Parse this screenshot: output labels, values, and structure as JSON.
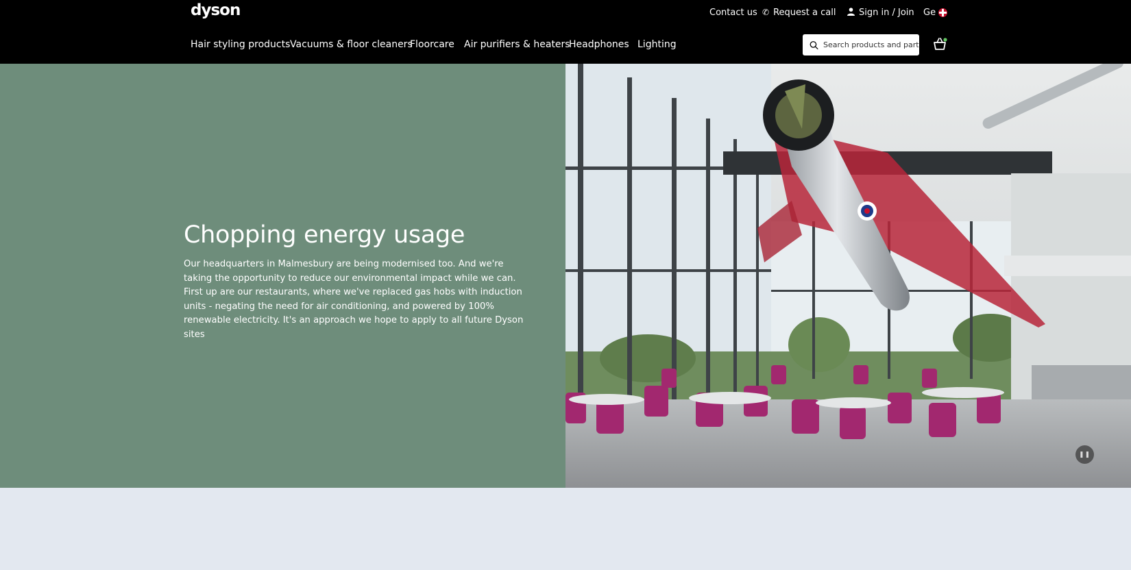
{
  "brand": {
    "logo": "dyson"
  },
  "utility": {
    "contact": "Contact us",
    "request_call": "Request a call",
    "sign_in": "Sign in / Join",
    "locale": "Ge"
  },
  "nav": {
    "items": [
      {
        "label": "Hair styling products"
      },
      {
        "label": "Vacuums & floor cleaners"
      },
      {
        "label": "Floorcare"
      },
      {
        "label": "Air purifiers & heaters"
      },
      {
        "label": "Headphones"
      },
      {
        "label": "Lighting"
      }
    ],
    "search_placeholder": "Search products and parts"
  },
  "hero": {
    "title": "Chopping energy usage",
    "body": "Our headquarters in Malmesbury are being modernised too. And we're taking the opportunity to reduce our environmental impact while we can. First up are our restaurants, where we've replaced gas hobs with induction units - negating the need for air conditioning, and powered by 100% renewable electricity. It's an approach we hope to apply to all future Dyson sites",
    "panel_color": "#6e8d7b",
    "image_subject": "dyson-canteen-with-suspended-jet",
    "pause_icon": "pause-icon"
  },
  "colors": {
    "header_bg": "#000000",
    "lower_bg": "#e3e8f0"
  }
}
